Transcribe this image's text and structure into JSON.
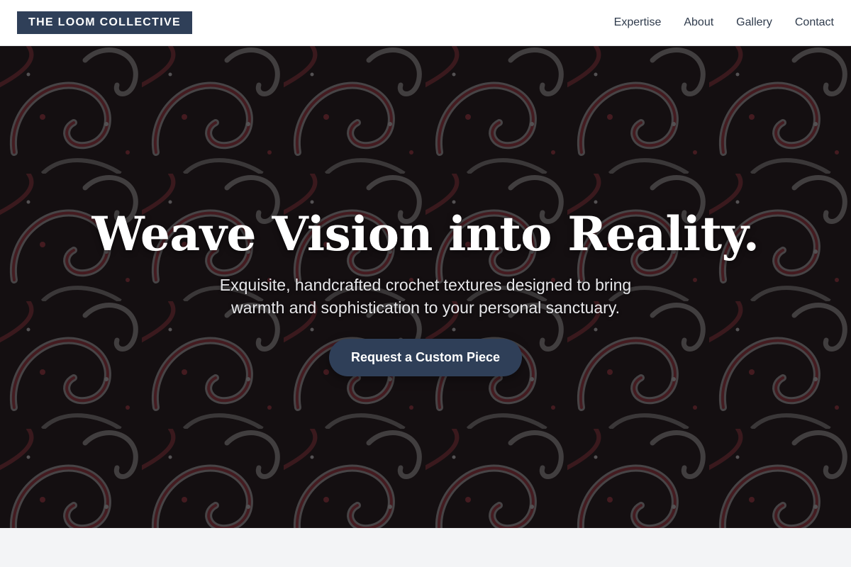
{
  "header": {
    "logo_text": "THE LOOM COLLECTIVE",
    "nav": [
      {
        "label": "Expertise"
      },
      {
        "label": "About"
      },
      {
        "label": "Gallery"
      },
      {
        "label": "Contact"
      }
    ]
  },
  "hero": {
    "title": "Weave Vision into Reality.",
    "subtitle": "Exquisite, handcrafted crochet textures designed to bring warmth and sophistication to your personal sanctuary.",
    "cta_label": "Request a Custom Piece"
  },
  "colors": {
    "brand": "#2f3f58",
    "nav_text": "#2f3b4c",
    "section_bg": "#f3f4f6",
    "pattern_dark": "#1c1617",
    "pattern_red": "#6e2a31",
    "pattern_grey": "#8a8788"
  }
}
